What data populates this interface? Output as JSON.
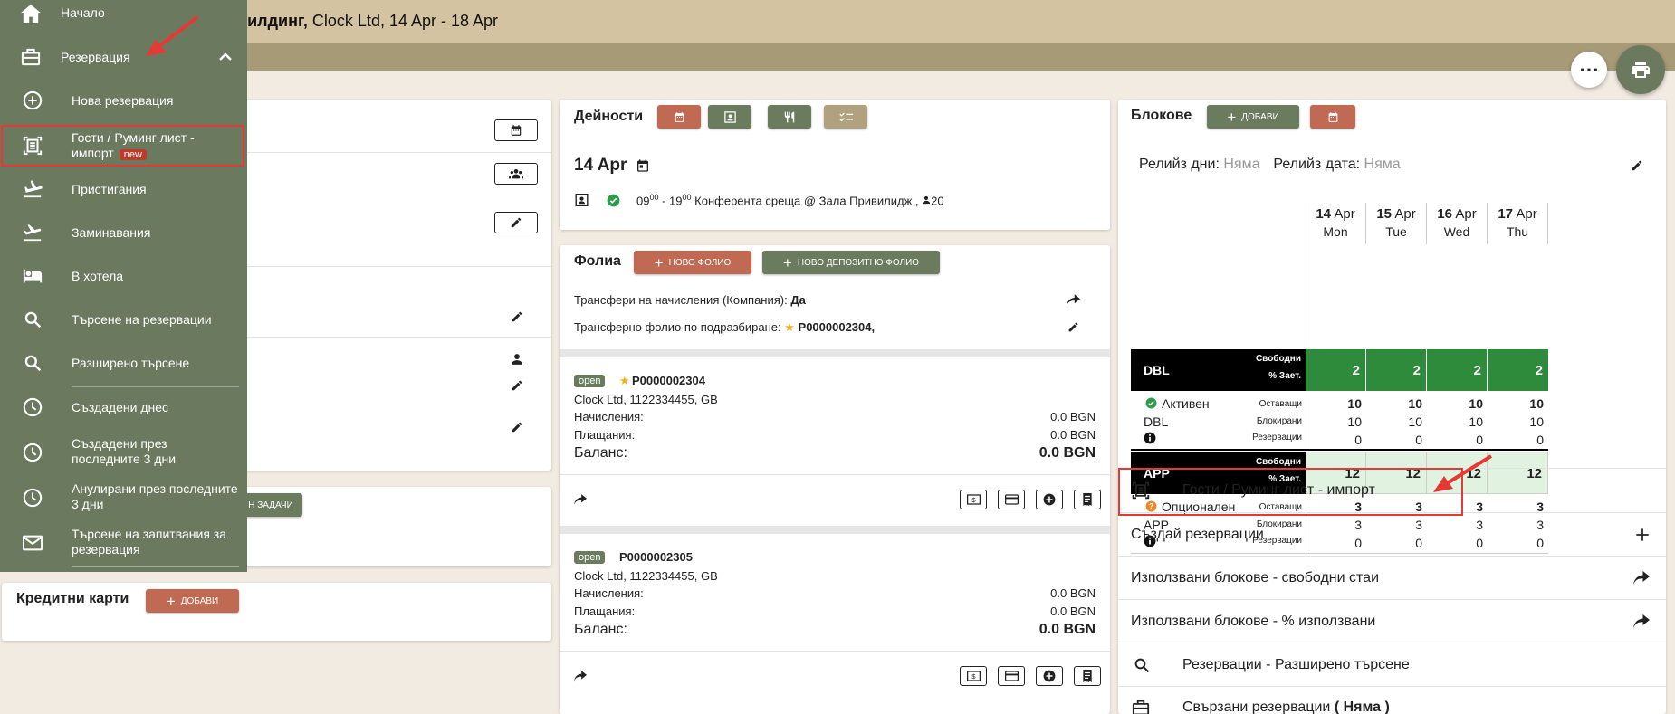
{
  "header": {
    "title_bold": "билдинг,",
    "title_rest": "Clock Ltd, 14 Apr - 18 Apr"
  },
  "colors": {
    "sidebar": "#6b7a5f",
    "accent_red": "#c06a53",
    "accent_green": "#6a7b5e",
    "header": "#d3c3a0",
    "highlight": "#e53935",
    "avail_dark": "#2e8b3c"
  },
  "sidebar": {
    "items": [
      {
        "label": "Начало",
        "icon": "home-icon"
      },
      {
        "label": "Резервация",
        "icon": "briefcase-icon"
      },
      {
        "label": "Нова резервация",
        "icon": "add-circle-icon"
      },
      {
        "label_line1": "Гости / Руминг лист -",
        "label_line2": "импорт",
        "badge": "new",
        "icon": "scan-document-icon"
      },
      {
        "label": "Пристигания",
        "icon": "plane-landing-icon"
      },
      {
        "label": "Заминавания",
        "icon": "plane-takeoff-icon"
      },
      {
        "label": "В хотела",
        "icon": "bed-icon"
      },
      {
        "label": "Търсене на резервации",
        "icon": "search-icon"
      },
      {
        "label": "Разширено търсене",
        "icon": "search-icon"
      },
      {
        "label": "Създадени днес",
        "icon": "clock-icon"
      },
      {
        "label_line1": "Създадени през",
        "label_line2": "последните 3 дни",
        "icon": "clock-icon"
      },
      {
        "label_line1": "Анулирани през последните",
        "label_line2": "3 дни",
        "icon": "clock-icon"
      },
      {
        "label_line1": "Търсене на запитвания за",
        "label_line2": "резервация",
        "icon": "mail-icon"
      }
    ]
  },
  "left": {
    "tasks_btn": "Н ЗАДАЧИ",
    "credit_cards_title": "Кредитни карти",
    "add_btn": "ДОБАВИ"
  },
  "activities": {
    "title": "Дейности",
    "date": "14 Apr",
    "event": {
      "start_h": "09",
      "start_m": "00",
      "sep": " - ",
      "end_h": "19",
      "end_m": "00",
      "text": "Конферента среща @ Зала Привилидж ,",
      "guests": "20"
    }
  },
  "folios": {
    "title": "Фолиа",
    "new_folio_btn": "НОВО ФОЛИО",
    "new_deposit_btn": "НОВО ДЕПОЗИТНО ФОЛИО",
    "transfers_label": "Трансфери на начисления (Компания):",
    "transfers_value": "Да",
    "default_label": "Трансферно фолио по подразбиране:",
    "default_value": "P0000002304,",
    "items": [
      {
        "status": "open",
        "number": "P0000002304",
        "company": "Clock Ltd, 1122334455, GB",
        "charges_label": "Начисления:",
        "charges": "0.0 BGN",
        "payments_label": "Плащания:",
        "payments": "0.0 BGN",
        "balance_label": "Баланс:",
        "balance": "0.0 BGN"
      },
      {
        "status": "open",
        "number": "P0000002305",
        "company": "Clock Ltd, 1122334455, GB",
        "charges_label": "Начисления:",
        "charges": "0.0 BGN",
        "payments_label": "Плащания:",
        "payments": "0.0 BGN",
        "balance_label": "Баланс:",
        "balance": "0.0 BGN"
      }
    ]
  },
  "blocks": {
    "title": "Блокове",
    "add_btn": "ДОБАВИ",
    "release_days_label": "Релийз дни:",
    "release_days_value": "Няма",
    "release_date_label": "Релийз дата:",
    "release_date_value": "Няма",
    "days": [
      {
        "day": "14",
        "month": "Apr",
        "dow": "Mon"
      },
      {
        "day": "15",
        "month": "Apr",
        "dow": "Tue"
      },
      {
        "day": "16",
        "month": "Apr",
        "dow": "Wed"
      },
      {
        "day": "17",
        "month": "Apr",
        "dow": "Thu"
      }
    ],
    "row_labels": {
      "free": "Свободни",
      "pct": "% Зает.",
      "remain": "Оставащи",
      "blocked": "Блокирани",
      "reservations": "Резервации"
    },
    "room_types": [
      {
        "code": "DBL",
        "status": "Активен",
        "sub": "DBL",
        "free": [
          "2",
          "2",
          "2",
          "2"
        ],
        "remain": [
          "10",
          "10",
          "10",
          "10"
        ],
        "blocked": [
          "10",
          "10",
          "10",
          "10"
        ],
        "reservations": [
          "0",
          "0",
          "0",
          "0"
        ]
      },
      {
        "code": "APP",
        "status": "Опционален",
        "sub": "APP",
        "free": [
          "12",
          "12",
          "12",
          "12"
        ],
        "remain": [
          "3",
          "3",
          "3",
          "3"
        ],
        "blocked": [
          "3",
          "3",
          "3",
          "3"
        ],
        "reservations": [
          "0",
          "0",
          "0",
          "0"
        ]
      }
    ],
    "actions": [
      {
        "label": "Гости / Руминг лист - импорт"
      },
      {
        "label": "Създай резервации"
      },
      {
        "label": "Използвани блокове - свободни стаи"
      },
      {
        "label": "Използвани блокове - % използвани"
      },
      {
        "label": "Резервации - Разширено търсене"
      },
      {
        "label": "Свързани резервации",
        "value": "( Няма )"
      }
    ]
  }
}
